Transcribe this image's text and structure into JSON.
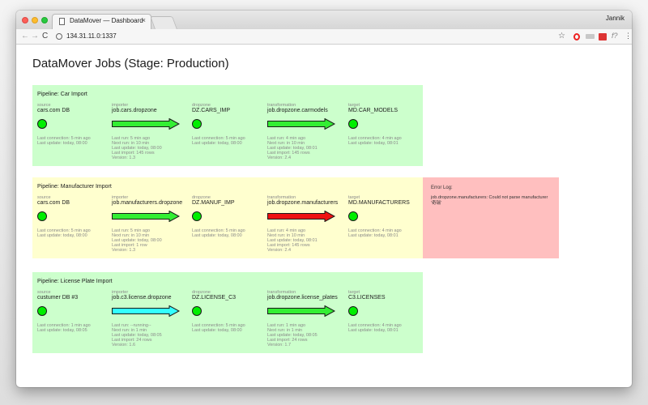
{
  "browser": {
    "tab_title": "DataMover — Dashboard",
    "tab_close": "×",
    "user_name": "Jannik",
    "address": "134.31.11.0:1337",
    "nav_back": "←",
    "nav_forward": "→",
    "nav_reload": "C",
    "star": "☆",
    "fx": "f?",
    "menu": "⋮",
    "colors": {
      "close": "#fc5f57",
      "minimize": "#fdbc2e",
      "maximize": "#29c840"
    }
  },
  "page": {
    "title": "DataMover Jobs (Stage: Production)"
  },
  "colors": {
    "ok_panel": "#ccffcc",
    "warn_panel": "#ffffcf",
    "error_panel": "#ffbfbf",
    "arrow_ok": "#33ee33",
    "arrow_error": "#ee1111",
    "arrow_running": "#33ffff",
    "dot_ok": "#00ee00"
  },
  "pipelines": [
    {
      "title": "Pipeline: Car Import",
      "stages": [
        {
          "type": "source",
          "name": "cars.com DB",
          "stats": [
            "Last connection: 5 min ago",
            "Last update: today, 08:00"
          ]
        },
        {
          "type": "importer",
          "name": "job.cars.dropzone",
          "status": "ok",
          "stats": [
            "Last run: 5 min ago",
            "Next run: in 10 min",
            "Last update: today, 08:00",
            "Last import: 145 rows",
            "Version: 1.3"
          ]
        },
        {
          "type": "dropzone",
          "name": "DZ.CARS_IMP",
          "stats": [
            "Last connection: 5 min ago",
            "Last update: today, 08:00"
          ]
        },
        {
          "type": "transformation",
          "name": "job.dropzone.carmodels",
          "status": "ok",
          "stats": [
            "Last run: 4 min ago",
            "Next run: in 10 min",
            "Last update: today, 08:01",
            "Last import: 145 rows",
            "Version: 2.4"
          ]
        },
        {
          "type": "target",
          "name": "MD.CAR_MODELS",
          "stats": [
            "Last connection: 4 min ago",
            "Last update: today, 08:01"
          ]
        }
      ]
    },
    {
      "title": "Pipeline: Manufacturer Import",
      "stages": [
        {
          "type": "source",
          "name": "cars.com DB",
          "stats": [
            "Last connection: 5 min ago",
            "Last update: today, 08:00"
          ]
        },
        {
          "type": "importer",
          "name": "job.manufacturers.dropzone",
          "status": "ok",
          "stats": [
            "Last run: 5 min ago",
            "Next run: in 10 min",
            "Last update: today, 08:00",
            "Last import: 1 row",
            "Version: 1.3"
          ]
        },
        {
          "type": "dropzone",
          "name": "DZ.MANUF_IMP",
          "stats": [
            "Last connection: 5 min ago",
            "Last update: today, 08:00"
          ]
        },
        {
          "type": "transformation",
          "name": "job.dropzone.manufacturers",
          "status": "error",
          "stats": [
            "Last run: 4 min ago",
            "Next run: in 10 min",
            "Last update: today, 08:01",
            "Last import: 145 rows",
            "Version: 2.4"
          ]
        },
        {
          "type": "target",
          "name": "MD.MANUFACTURERS",
          "stats": [
            "Last connection: 4 min ago",
            "Last update: today, 08:01"
          ]
        }
      ],
      "error": {
        "title": "Error Log:",
        "message": "job.dropzone.manufacturers: Could not parse manufacturer '奇瑞'"
      }
    },
    {
      "title": "Pipeline: License Plate Import",
      "stages": [
        {
          "type": "source",
          "name": "custumer DB #3",
          "stats": [
            "Last connection: 1 min ago",
            "Last update: today, 08:05"
          ]
        },
        {
          "type": "importer",
          "name": "job.c3.license.dropzone",
          "status": "running",
          "stats": [
            "Last run: --running--",
            "Next run: in 1 min",
            "Last update: today, 08:05",
            "Last import: 24 rows",
            "Version: 1.6"
          ]
        },
        {
          "type": "dropzone",
          "name": "DZ.LICENSE_C3",
          "stats": [
            "Last connection: 5 min ago",
            "Last update: today, 08:00"
          ]
        },
        {
          "type": "transformation",
          "name": "job.dropzone.license_plates",
          "status": "ok",
          "stats": [
            "Last run: 1 min ago",
            "Next run: in 1 min",
            "Last update: today, 08:05",
            "Last import: 24 rows",
            "Version: 1.7"
          ]
        },
        {
          "type": "target",
          "name": "C3.LICENSES",
          "stats": [
            "Last connection: 4 min ago",
            "Last update: today, 08:01"
          ]
        }
      ]
    }
  ]
}
